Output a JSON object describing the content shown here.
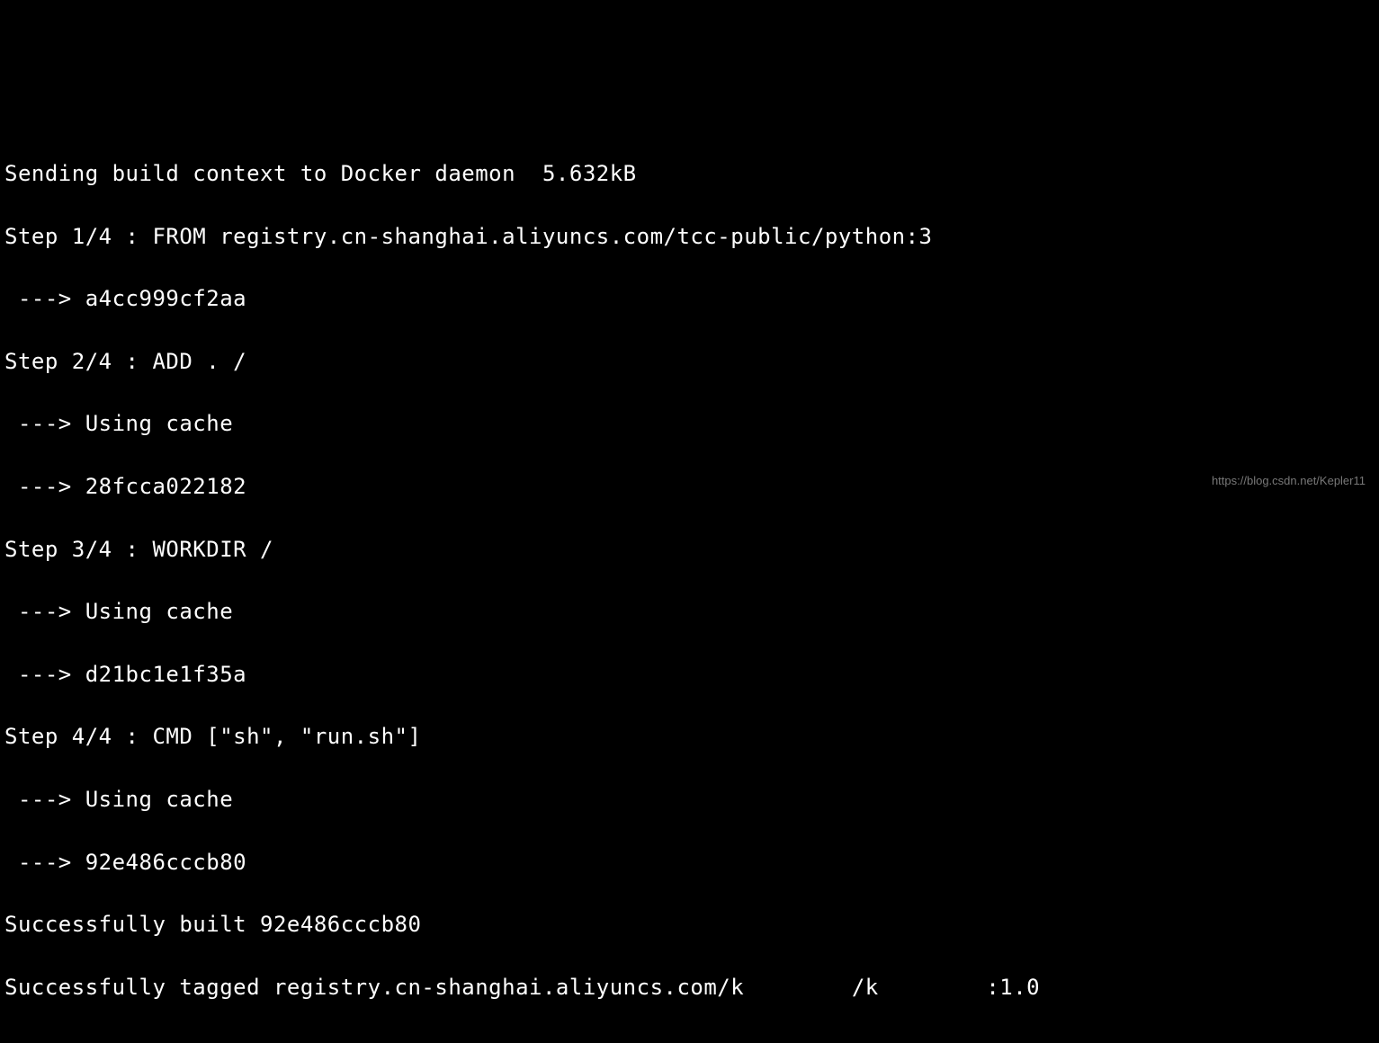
{
  "terminal": {
    "lines": [
      "Sending build context to Docker daemon  5.632kB",
      "Step 1/4 : FROM registry.cn-shanghai.aliyuncs.com/tcc-public/python:3",
      " ---> a4cc999cf2aa",
      "Step 2/4 : ADD . /",
      " ---> Using cache",
      " ---> 28fcca022182",
      "Step 3/4 : WORKDIR /",
      " ---> Using cache",
      " ---> d21bc1e1f35a",
      "Step 4/4 : CMD [\"sh\", \"run.sh\"]",
      " ---> Using cache",
      " ---> 92e486cccb80",
      "Successfully built 92e486cccb80"
    ],
    "tagged_prefix": "Successfully tagged registry.cn-shanghai.aliyuncs.com/k",
    "tagged_redacted_mid": "/k",
    "tagged_suffix": ":1.0"
  },
  "watermark": "https://blog.csdn.net/Kepler11"
}
